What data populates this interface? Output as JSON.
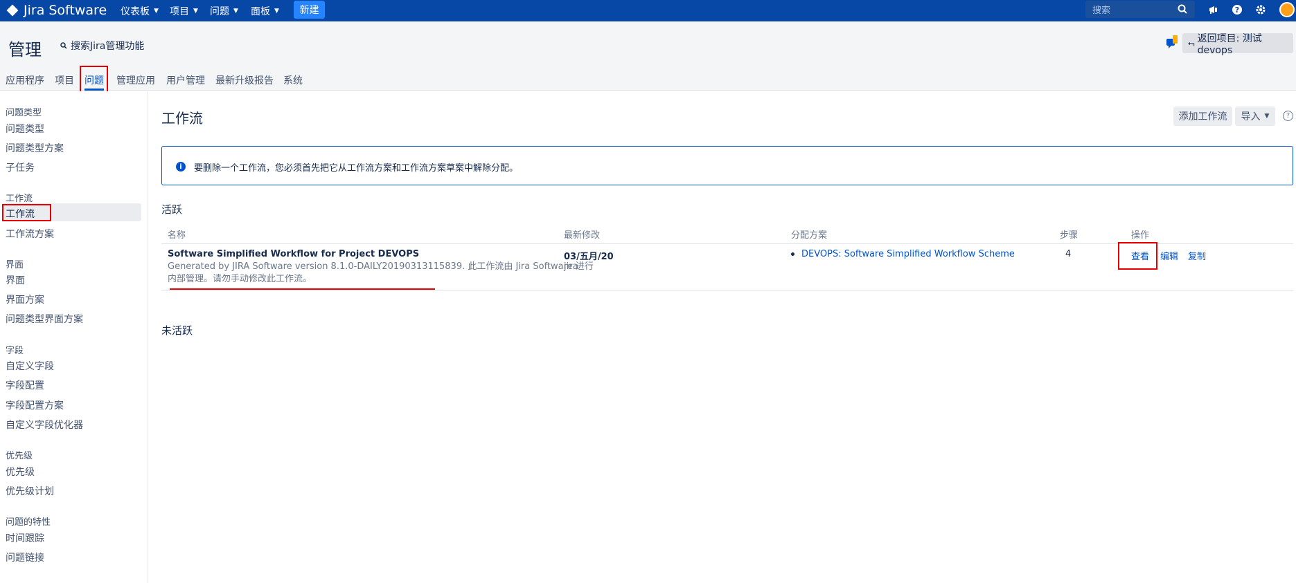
{
  "topbar": {
    "logo_text": "Jira Software",
    "nav": [
      {
        "label": "仪表板"
      },
      {
        "label": "项目"
      },
      {
        "label": "问题"
      },
      {
        "label": "面板"
      }
    ],
    "create_label": "新建",
    "search_placeholder": "搜索",
    "bg_color": "#0747a6"
  },
  "admin": {
    "title": "管理",
    "search_label": "搜索Jira管理功能",
    "back_label": "返回项目: 测试devops",
    "tabs": [
      {
        "label": "应用程序"
      },
      {
        "label": "项目"
      },
      {
        "label": "问题"
      },
      {
        "label": "管理应用"
      },
      {
        "label": "用户管理"
      },
      {
        "label": "最新升级报告"
      },
      {
        "label": "系统"
      }
    ]
  },
  "sidebar": {
    "groups": [
      {
        "header": "问题类型",
        "items": [
          "问题类型",
          "问题类型方案",
          "子任务"
        ]
      },
      {
        "header": "工作流",
        "items": [
          "工作流",
          "工作流方案"
        ]
      },
      {
        "header": "界面",
        "items": [
          "界面",
          "界面方案",
          "问题类型界面方案"
        ]
      },
      {
        "header": "字段",
        "items": [
          "自定义字段",
          "字段配置",
          "字段配置方案",
          "自定义字段优化器"
        ]
      },
      {
        "header": "优先级",
        "items": [
          "优先级",
          "优先级计划"
        ]
      },
      {
        "header": "问题的特性",
        "items": [
          "时间跟踪",
          "问题链接"
        ]
      }
    ]
  },
  "main": {
    "title": "工作流",
    "add_button": "添加工作流",
    "import_button": "导入",
    "info_message": "要删除一个工作流，您必须首先把它从工作流方案和工作流方案草案中解除分配。",
    "active_header": "活跃",
    "inactive_header": "未活跃",
    "columns": [
      "名称",
      "最新修改",
      "分配方案",
      "步骤",
      "操作"
    ],
    "row": {
      "name": "Software Simplified Workflow for Project DEVOPS",
      "desc_line1": "Generated by JIRA Software version 8.1.0-DAILY20190313115839. 此工作流由 Jira Software 进行",
      "desc_line2": "内部管理。请勿手动修改此工作流。",
      "modified_date": "03/五月/20",
      "modified_by": "jira",
      "scheme": "DEVOPS: Software Simplified Workflow Scheme",
      "steps": "4",
      "actions": [
        "查看",
        "编辑",
        "复制"
      ]
    }
  }
}
